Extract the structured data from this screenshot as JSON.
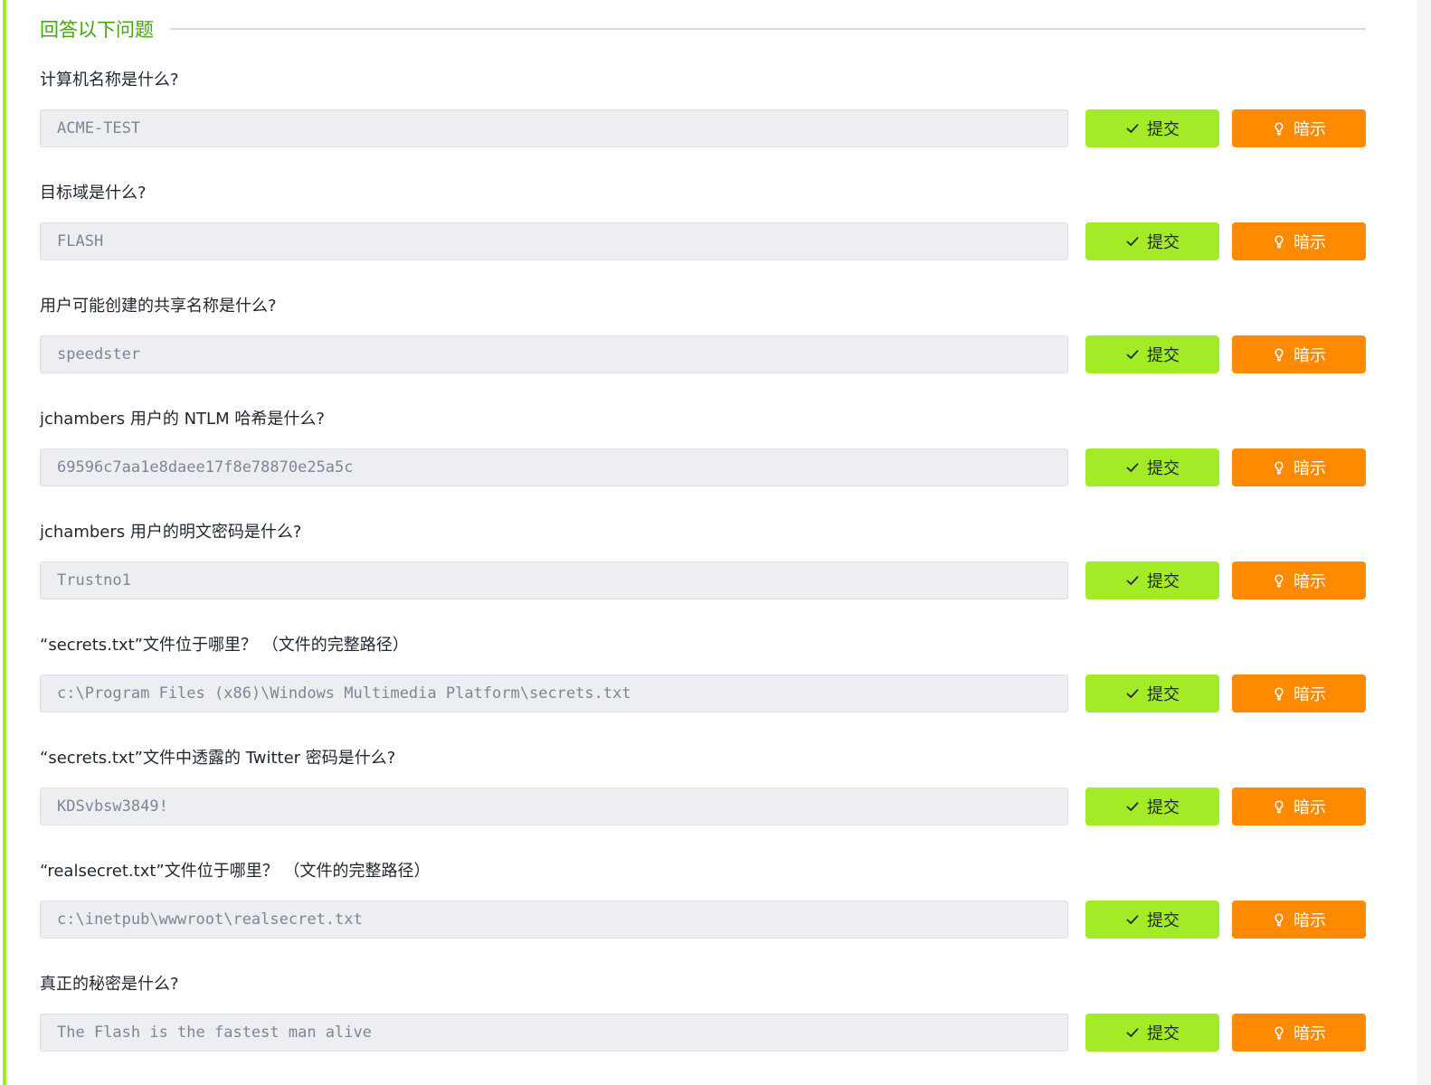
{
  "section": {
    "title": "回答以下问题"
  },
  "buttons": {
    "submit_label": "提交",
    "hint_label": "暗示",
    "submit_icon": "check-icon",
    "hint_icon": "lightbulb-icon"
  },
  "colors": {
    "accent": "#a3eb27",
    "title_green": "#44a510",
    "hint_orange": "#ff8a00"
  },
  "questions": [
    {
      "label": "计算机名称是什么?",
      "answer": "ACME-TEST"
    },
    {
      "label": "目标域是什么?",
      "answer": "FLASH"
    },
    {
      "label": "用户可能创建的共享名称是什么?",
      "answer": "speedster"
    },
    {
      "label": "jchambers 用户的 NTLM 哈希是什么?",
      "answer": "69596c7aa1e8daee17f8e78870e25a5c"
    },
    {
      "label": "jchambers 用户的明文密码是什么?",
      "answer": "Trustno1"
    },
    {
      "label": "“secrets.txt”文件位于哪里？ （文件的完整路径）",
      "answer": "c:\\Program Files (x86)\\Windows Multimedia Platform\\secrets.txt"
    },
    {
      "label": "“secrets.txt”文件中透露的 Twitter 密码是什么?",
      "answer": "KDSvbsw3849!"
    },
    {
      "label": "“realsecret.txt”文件位于哪里？ （文件的完整路径）",
      "answer": "c:\\inetpub\\wwwroot\\realsecret.txt"
    },
    {
      "label": "真正的秘密是什么?",
      "answer": "The Flash is the fastest man alive"
    }
  ]
}
